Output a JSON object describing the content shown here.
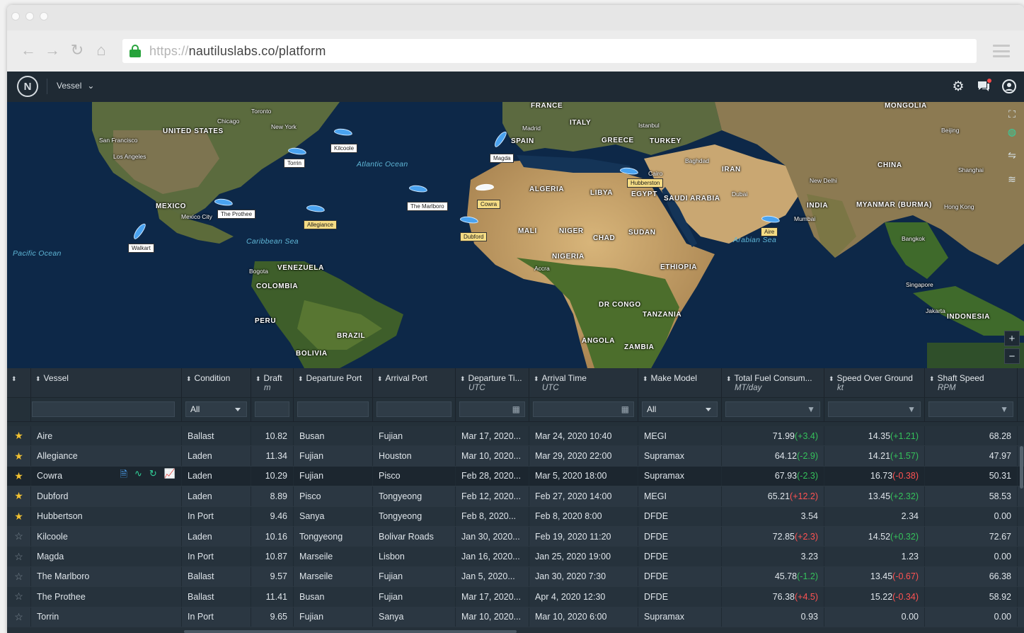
{
  "browser": {
    "url_protocol": "https://",
    "url_host": "nautiluslabs.co/platform",
    "nav": {
      "back": "←",
      "forward": "→",
      "reload": "↻",
      "home": "⌂"
    }
  },
  "app": {
    "logo_glyph": "N",
    "vessel_menu_label": "Vessel",
    "icons": [
      "gear-icon",
      "chat-icon",
      "user-icon"
    ]
  },
  "map": {
    "countries": [
      "UNITED STATES",
      "MEXICO",
      "VENEZUELA",
      "COLOMBIA",
      "PERU",
      "BRAZIL",
      "BOLIVIA",
      "FRANCE",
      "SPAIN",
      "ITALY",
      "GREECE",
      "TURKEY",
      "ALGERIA",
      "LIBYA",
      "EGYPT",
      "MALI",
      "NIGER",
      "CHAD",
      "SUDAN",
      "NIGERIA",
      "ETHIOPIA",
      "DR CONGO",
      "TANZANIA",
      "ANGOLA",
      "ZAMBIA",
      "SAUDI ARABIA",
      "IRAN",
      "INDIA",
      "CHINA",
      "MONGOLIA",
      "MYANMAR (BURMA)",
      "INDONESIA"
    ],
    "cities": [
      "Toronto",
      "Chicago",
      "New York",
      "San Francisco",
      "Los Angeles",
      "Mexico City",
      "Bogota",
      "Madrid",
      "Istanbul",
      "Cairo",
      "Baghdad",
      "Dubai",
      "New Delhi",
      "Mumbai",
      "Beijing",
      "Shanghai",
      "Hong Kong",
      "Bangkok",
      "Singapore",
      "Jakarta",
      "Accra"
    ],
    "oceans": {
      "atlantic": "Atlantic Ocean",
      "pacific": "Pacific Ocean",
      "caribbean": "Caribbean Sea",
      "arabian": "Arabian Sea"
    },
    "ship_labels": [
      "Kilcoole",
      "Torrin",
      "Magda",
      "The Marlboro",
      "Cowra",
      "Dubford",
      "The Prothee",
      "Allegiance",
      "Walkart",
      "Hubberston",
      "Aire"
    ]
  },
  "table": {
    "columns": [
      {
        "label": "",
        "unit": ""
      },
      {
        "label": "Vessel",
        "unit": ""
      },
      {
        "label": "Condition",
        "unit": ""
      },
      {
        "label": "Draft",
        "unit": "m"
      },
      {
        "label": "Departure Port",
        "unit": ""
      },
      {
        "label": "Arrival Port",
        "unit": ""
      },
      {
        "label": "Departure Ti...",
        "unit": "UTC"
      },
      {
        "label": "Arrival Time",
        "unit": "UTC"
      },
      {
        "label": "Make Model",
        "unit": ""
      },
      {
        "label": "Total Fuel Consum...",
        "unit": "MT/day"
      },
      {
        "label": "Speed Over Ground",
        "unit": "kt"
      },
      {
        "label": "Shaft Speed",
        "unit": "RPM"
      }
    ],
    "filters": {
      "condition": "All",
      "make_model": "All"
    },
    "rows": [
      {
        "starred": true,
        "vessel": "Aire",
        "condition": "Ballast",
        "draft": "10.82",
        "dep_port": "Busan",
        "arr_port": "Fujian",
        "dep_time": "Mar 17, 2020...",
        "arr_time": "Mar 24, 2020  10:40",
        "model": "MEGI",
        "fuel": "71.99",
        "fuel_delta": "(+3.4)",
        "fuel_sign": "pos",
        "sog": "14.35",
        "sog_delta": "(+1.21)",
        "sog_sign": "pos",
        "shaft": "68.28"
      },
      {
        "starred": true,
        "vessel": "Allegiance",
        "condition": "Laden",
        "draft": "11.34",
        "dep_port": "Fujian",
        "arr_port": "Houston",
        "dep_time": "Mar 10, 2020...",
        "arr_time": "Mar 29, 2020  22:00",
        "model": "Supramax",
        "fuel": "64.12",
        "fuel_delta": "(-2.9)",
        "fuel_sign": "pos",
        "sog": "14.21",
        "sog_delta": "(+1.57)",
        "sog_sign": "pos",
        "shaft": "47.97"
      },
      {
        "starred": true,
        "vessel": "Cowra",
        "condition": "Laden",
        "draft": "10.29",
        "dep_port": "Fujian",
        "arr_port": "Pisco",
        "dep_time": "Feb 28, 2020...",
        "arr_time": "Mar 5, 2020  18:00",
        "model": "Supramax",
        "fuel": "67.93",
        "fuel_delta": "(-2.3)",
        "fuel_sign": "pos",
        "sog": "16.73",
        "sog_delta": "(-0.38)",
        "sog_sign": "neg",
        "shaft": "50.31",
        "selected": true
      },
      {
        "starred": true,
        "vessel": "Dubford",
        "condition": "Laden",
        "draft": "8.89",
        "dep_port": "Pisco",
        "arr_port": "Tongyeong",
        "dep_time": "Feb 12, 2020...",
        "arr_time": "Feb 27, 2020  14:00",
        "model": "MEGI",
        "fuel": "65.21",
        "fuel_delta": "(+12.2)",
        "fuel_sign": "neg",
        "sog": "13.45",
        "sog_delta": "(+2.32)",
        "sog_sign": "pos",
        "shaft": "58.53"
      },
      {
        "starred": true,
        "vessel": "Hubbertson",
        "condition": "In Port",
        "draft": "9.46",
        "dep_port": "Sanya",
        "arr_port": "Tongyeong",
        "dep_time": "Feb 8, 2020...",
        "arr_time": "Feb 8, 2020  8:00",
        "model": "DFDE",
        "fuel": "3.54",
        "fuel_delta": "",
        "fuel_sign": "",
        "sog": "2.34",
        "sog_delta": "",
        "sog_sign": "",
        "shaft": "0.00"
      },
      {
        "starred": false,
        "vessel": "Kilcoole",
        "condition": "Laden",
        "draft": "10.16",
        "dep_port": "Tongyeong",
        "arr_port": "Bolivar Roads",
        "dep_time": "Jan 30, 2020...",
        "arr_time": "Feb 19, 2020  11:20",
        "model": "DFDE",
        "fuel": "72.85",
        "fuel_delta": "(+2.3)",
        "fuel_sign": "neg",
        "sog": "14.52",
        "sog_delta": "(+0.32)",
        "sog_sign": "pos",
        "shaft": "72.67"
      },
      {
        "starred": false,
        "vessel": "Magda",
        "condition": "In Port",
        "draft": "10.87",
        "dep_port": "Marseile",
        "arr_port": "Lisbon",
        "dep_time": "Jan 16, 2020...",
        "arr_time": "Jan 25, 2020  19:00",
        "model": "DFDE",
        "fuel": "3.23",
        "fuel_delta": "",
        "fuel_sign": "",
        "sog": "1.23",
        "sog_delta": "",
        "sog_sign": "",
        "shaft": "0.00"
      },
      {
        "starred": false,
        "vessel": "The  Marlboro",
        "condition": "Ballast",
        "draft": "9.57",
        "dep_port": "Marseile",
        "arr_port": "Fujian",
        "dep_time": "Jan 5, 2020...",
        "arr_time": "Jan 30, 2020  7:30",
        "model": "DFDE",
        "fuel": "45.78",
        "fuel_delta": "(-1.2)",
        "fuel_sign": "pos",
        "sog": "13.45",
        "sog_delta": "(-0.67)",
        "sog_sign": "neg",
        "shaft": "66.38"
      },
      {
        "starred": false,
        "vessel": "The Prothee",
        "condition": "Ballast",
        "draft": "11.41",
        "dep_port": "Busan",
        "arr_port": "Fujian",
        "dep_time": "Mar 17, 2020...",
        "arr_time": "Apr 4, 2020  12:30",
        "model": "DFDE",
        "fuel": "76.38",
        "fuel_delta": "(+4.5)",
        "fuel_sign": "neg",
        "sog": "15.22",
        "sog_delta": "(-0.34)",
        "sog_sign": "neg",
        "shaft": "58.92"
      },
      {
        "starred": false,
        "vessel": "Torrin",
        "condition": "In Port",
        "draft": "9.65",
        "dep_port": "Fujian",
        "arr_port": "Sanya",
        "dep_time": "Mar 10, 2020...",
        "arr_time": "Mar 10, 2020  6:00",
        "model": "Supramax",
        "fuel": "0.93",
        "fuel_delta": "",
        "fuel_sign": "",
        "sog": "0.00",
        "sog_delta": "",
        "sog_sign": "",
        "shaft": "0.00"
      }
    ]
  },
  "colors": {
    "app_bar": "#1f2a34",
    "grid_bg": "#253039",
    "star": "#f2c231",
    "positive": "#35c15b",
    "negative": "#ff5252"
  }
}
